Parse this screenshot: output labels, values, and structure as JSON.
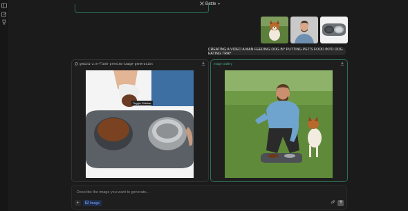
{
  "header": {
    "mode_label": "Battle"
  },
  "prompt": {
    "text": "CREATING A VIDEO A MAN FEEDING DOG BY PUTTING PET'S FOOD INTO DOG EATING TRAY"
  },
  "results": [
    {
      "model_name": "gemini-2.0-flash-preview-image-generation",
      "tooltip": "Toggle Sidebar"
    },
    {
      "model_name": "Image Gallery"
    }
  ],
  "composer": {
    "placeholder": "Describe the image you want to generate...",
    "image_chip_label": "Image"
  },
  "icons": {
    "topbar": "swords-icon",
    "sidebar": [
      "sidebar-toggle-icon",
      "new-chat-icon",
      "trophy-icon"
    ],
    "actions": [
      "download-icon",
      "attach-icon",
      "send-arrow-icon",
      "plus-icon",
      "image-icon",
      "chevron-down-icon"
    ]
  },
  "colors": {
    "background": "#1b1b1b",
    "accent_green": "#4fb58a",
    "chip_blue": "#7fa6ff"
  }
}
